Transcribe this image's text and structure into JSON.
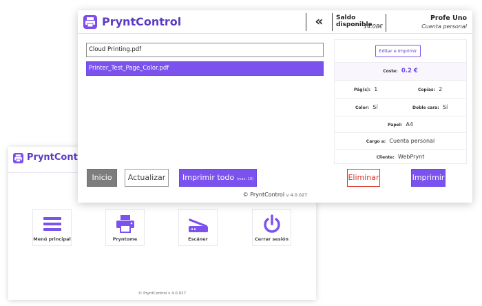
{
  "colors": {
    "accent": "#7b52ee",
    "brand_text": "#5a3cc4",
    "danger": "#d9342b",
    "inicio_gray": "#7d7d7d"
  },
  "back_window": {
    "title": "PryntControl",
    "tiles": [
      {
        "icon": "menu-icon",
        "label": "Menú principal"
      },
      {
        "icon": "printer-icon",
        "label": "Pryntome"
      },
      {
        "icon": "scanner-icon",
        "label": "Escáner"
      },
      {
        "icon": "power-icon",
        "label": "Cerrar sesión"
      }
    ],
    "footer": {
      "copyright": "© PryntControl",
      "version": "v 4.0.027"
    }
  },
  "front_window": {
    "title": "PryntControl",
    "collapse_glyph": "«",
    "balance": {
      "label": "Saldo disponible",
      "value": "14.08€"
    },
    "user": {
      "name": "Profe Uno",
      "account": "Cuenta personal"
    },
    "files": [
      {
        "name": "Cloud Printing.pdf",
        "selected": false
      },
      {
        "name": "Printer_Test_Page_Color.pdf",
        "selected": true
      }
    ],
    "details": {
      "edit_label": "Editar e Imprimir",
      "cost_label": "Coste:",
      "cost_value": "0.2 €",
      "pages_label": "Pág(s):",
      "pages_value": "1",
      "copies_label": "Copias:",
      "copies_value": "2",
      "color_label": "Color:",
      "color_value": "Sí",
      "duplex_label": "Doble cara:",
      "duplex_value": "Sí",
      "paper_label": "Papel:",
      "paper_value": "A4",
      "charge_label": "Cargo a:",
      "charge_value": "Cuenta personal",
      "client_label": "Cliente:",
      "client_value": "WebPrynt"
    },
    "buttons": {
      "inicio": "Inicio",
      "actualizar": "Actualizar",
      "imprimir_todo": "Imprimir todo",
      "imprimir_todo_small": "(max. 10)",
      "eliminar": "Eliminar",
      "imprimir": "Imprimir"
    },
    "footer": {
      "copyright": "© PryntControl",
      "version": "v 4.0.027"
    }
  }
}
